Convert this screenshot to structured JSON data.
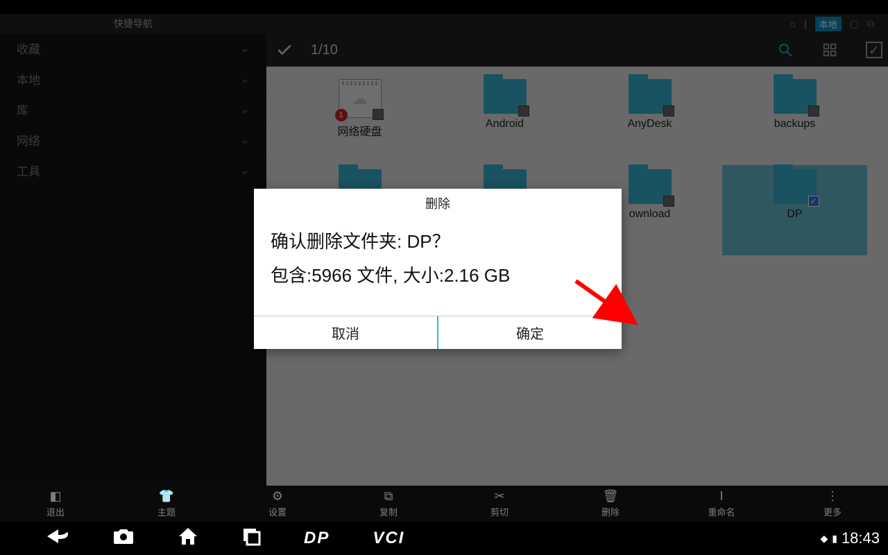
{
  "topbar": {
    "quicknav": "快捷导航",
    "local_label": "本地"
  },
  "sidebar": {
    "items": [
      {
        "label": "收藏"
      },
      {
        "label": "本地"
      },
      {
        "label": "库"
      },
      {
        "label": "网络"
      },
      {
        "label": "工具"
      }
    ]
  },
  "header": {
    "selection_count": "1/10"
  },
  "grid": {
    "items": [
      {
        "label": "网络硬盘",
        "kind": "netdisk",
        "badge": "1"
      },
      {
        "label": "Android",
        "kind": "folder"
      },
      {
        "label": "AnyDesk",
        "kind": "folder"
      },
      {
        "label": "backups",
        "kind": "folder"
      },
      {
        "label": "",
        "kind": "folder"
      },
      {
        "label": "",
        "kind": "folder"
      },
      {
        "label": "ownload",
        "kind": "folder"
      },
      {
        "label": "DP",
        "kind": "folder",
        "selected": true,
        "checked": true
      }
    ]
  },
  "dialog": {
    "title": "删除",
    "line1": "确认删除文件夹: DP？",
    "line2": "包含:5966 文件, 大小:2.16 GB",
    "cancel": "取消",
    "ok": "确定"
  },
  "toolbar": {
    "items": [
      {
        "label": "退出",
        "icon": "exit"
      },
      {
        "label": "主题",
        "icon": "theme"
      },
      {
        "label": "设置",
        "icon": "settings"
      },
      {
        "label": "复制",
        "icon": "copy"
      },
      {
        "label": "剪切",
        "icon": "cut"
      },
      {
        "label": "删除",
        "icon": "delete"
      },
      {
        "label": "重命名",
        "icon": "rename"
      },
      {
        "label": "更多",
        "icon": "more"
      }
    ]
  },
  "sysbar": {
    "logo1": "DP",
    "logo2": "VCI",
    "time": "18:43"
  }
}
